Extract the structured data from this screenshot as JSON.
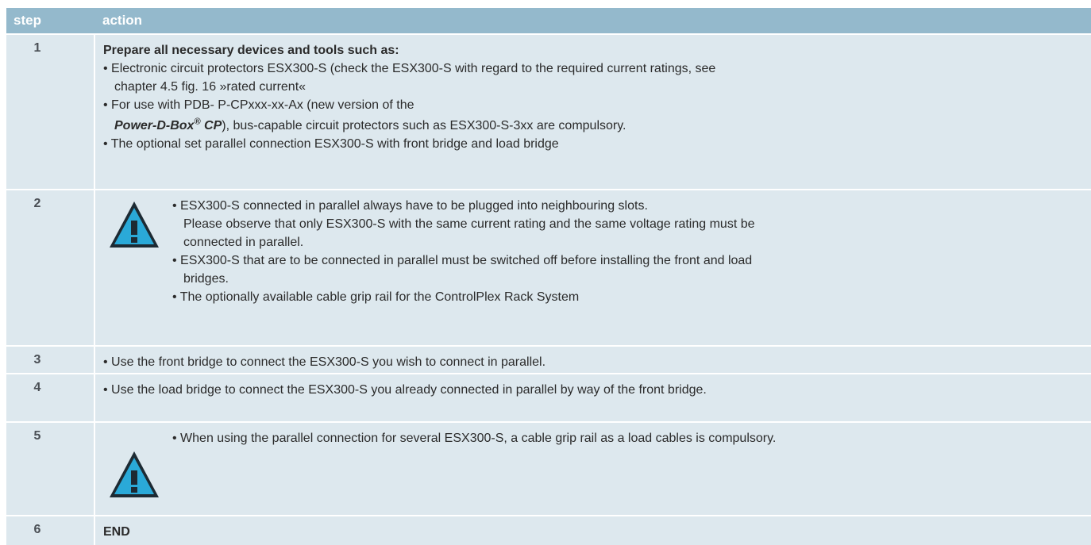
{
  "header": {
    "step": "step",
    "action": "action"
  },
  "rows": [
    {
      "step": "1",
      "title": "Prepare all necessary devices and tools such as:",
      "b1_l1": "• Electronic circuit protectors ESX300-S (check the ESX300-S with regard to the required current ratings, see",
      "b1_l2": "chapter 4.5 fig. 16 »rated current«",
      "b2_l1": "• For use with PDB- P-CPxxx-xx-Ax (new version of the",
      "b2_brand": "Power-D-Box",
      "b2_reg": "®",
      "b2_cp": " CP",
      "b2_rest": "), bus-capable circuit protectors such as ESX300-S-3xx are compulsory.",
      "b3": "• The optional set parallel connection ESX300-S with front bridge and load bridge"
    },
    {
      "step": "2",
      "icon": "warning-icon",
      "b1_l1": "• ESX300-S connected in parallel always have to be plugged into neighbouring slots.",
      "b1_l2": "Please observe that only ESX300-S with the same current rating and the same voltage rating must be",
      "b1_l3": "connected in parallel.",
      "b2_l1": "• ESX300-S that are to be connected in parallel must be switched off before installing the front and load",
      "b2_l2": "bridges.",
      "b3": "• The optionally available cable grip rail for the ControlPlex Rack System"
    },
    {
      "step": "3",
      "text": "• Use the front bridge to connect the ESX300-S you wish to connect in parallel."
    },
    {
      "step": "4",
      "text": "• Use the load bridge to connect the ESX300-S you already connected in parallel by way of the front bridge."
    },
    {
      "step": "5",
      "icon": "warning-icon",
      "text": "• When using the parallel connection for several ESX300-S, a cable grip rail as a load cables is compulsory."
    },
    {
      "step": "6",
      "text": "END"
    }
  ],
  "colors": {
    "header_bg": "#94b9cc",
    "row_bg": "#dde8ee",
    "warning_fill": "#2aa9d8"
  }
}
